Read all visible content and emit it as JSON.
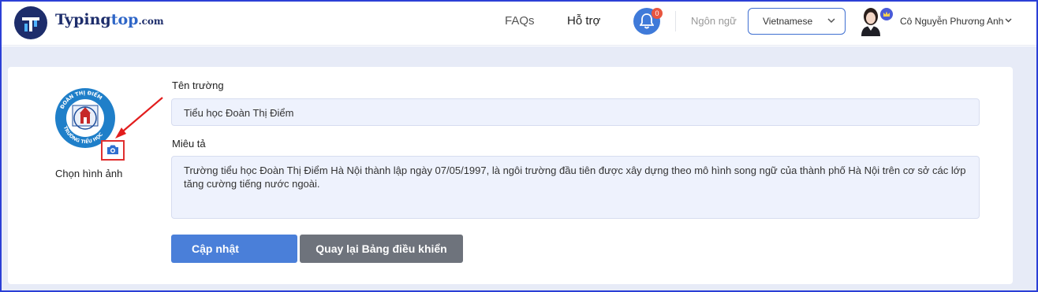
{
  "header": {
    "logo": {
      "brand": "Typing",
      "brand_accent": "top",
      "domain": ".com"
    },
    "nav": {
      "faq": "FAQs",
      "support": "Hỗ trợ"
    },
    "notifications": {
      "count": "0"
    },
    "language": {
      "label": "Ngôn ngữ",
      "selected": "Vietnamese"
    },
    "user": {
      "name": "Cô Nguyễn Phương Anh"
    }
  },
  "form": {
    "choose_image_label": "Chọn hình ảnh",
    "school_name_label": "Tên trường",
    "school_name_value": "Tiểu học Đoàn Thị Điểm",
    "description_label": "Miêu tả",
    "description_value": "Trường tiểu học Đoàn Thị Điểm Hà Nội thành lập ngày 07/05/1997, là ngôi trường đầu tiên được xây dựng theo mô hình song ngữ của thành phố Hà Nội trên cơ sở các lớp tăng cường tiếng nước ngoài.",
    "update_button": "Cập nhật",
    "back_button": "Quay lại Bảng điều khiển"
  },
  "school_logo": {
    "ring_text_top": "ĐOÀN THỊ ĐIỂM",
    "ring_text_bottom": "TRƯỜNG TIỂU HỌC"
  },
  "colors": {
    "brand_navy": "#1d2d6b",
    "primary_blue": "#4a7fd9",
    "secondary_gray": "#6e737c",
    "page_background": "#e7ebf7",
    "highlight_red": "#e03030"
  },
  "icons": [
    "logo-icon",
    "bell-icon",
    "chevron-down-icon",
    "crown-icon",
    "camera-icon",
    "arrow-icon"
  ]
}
